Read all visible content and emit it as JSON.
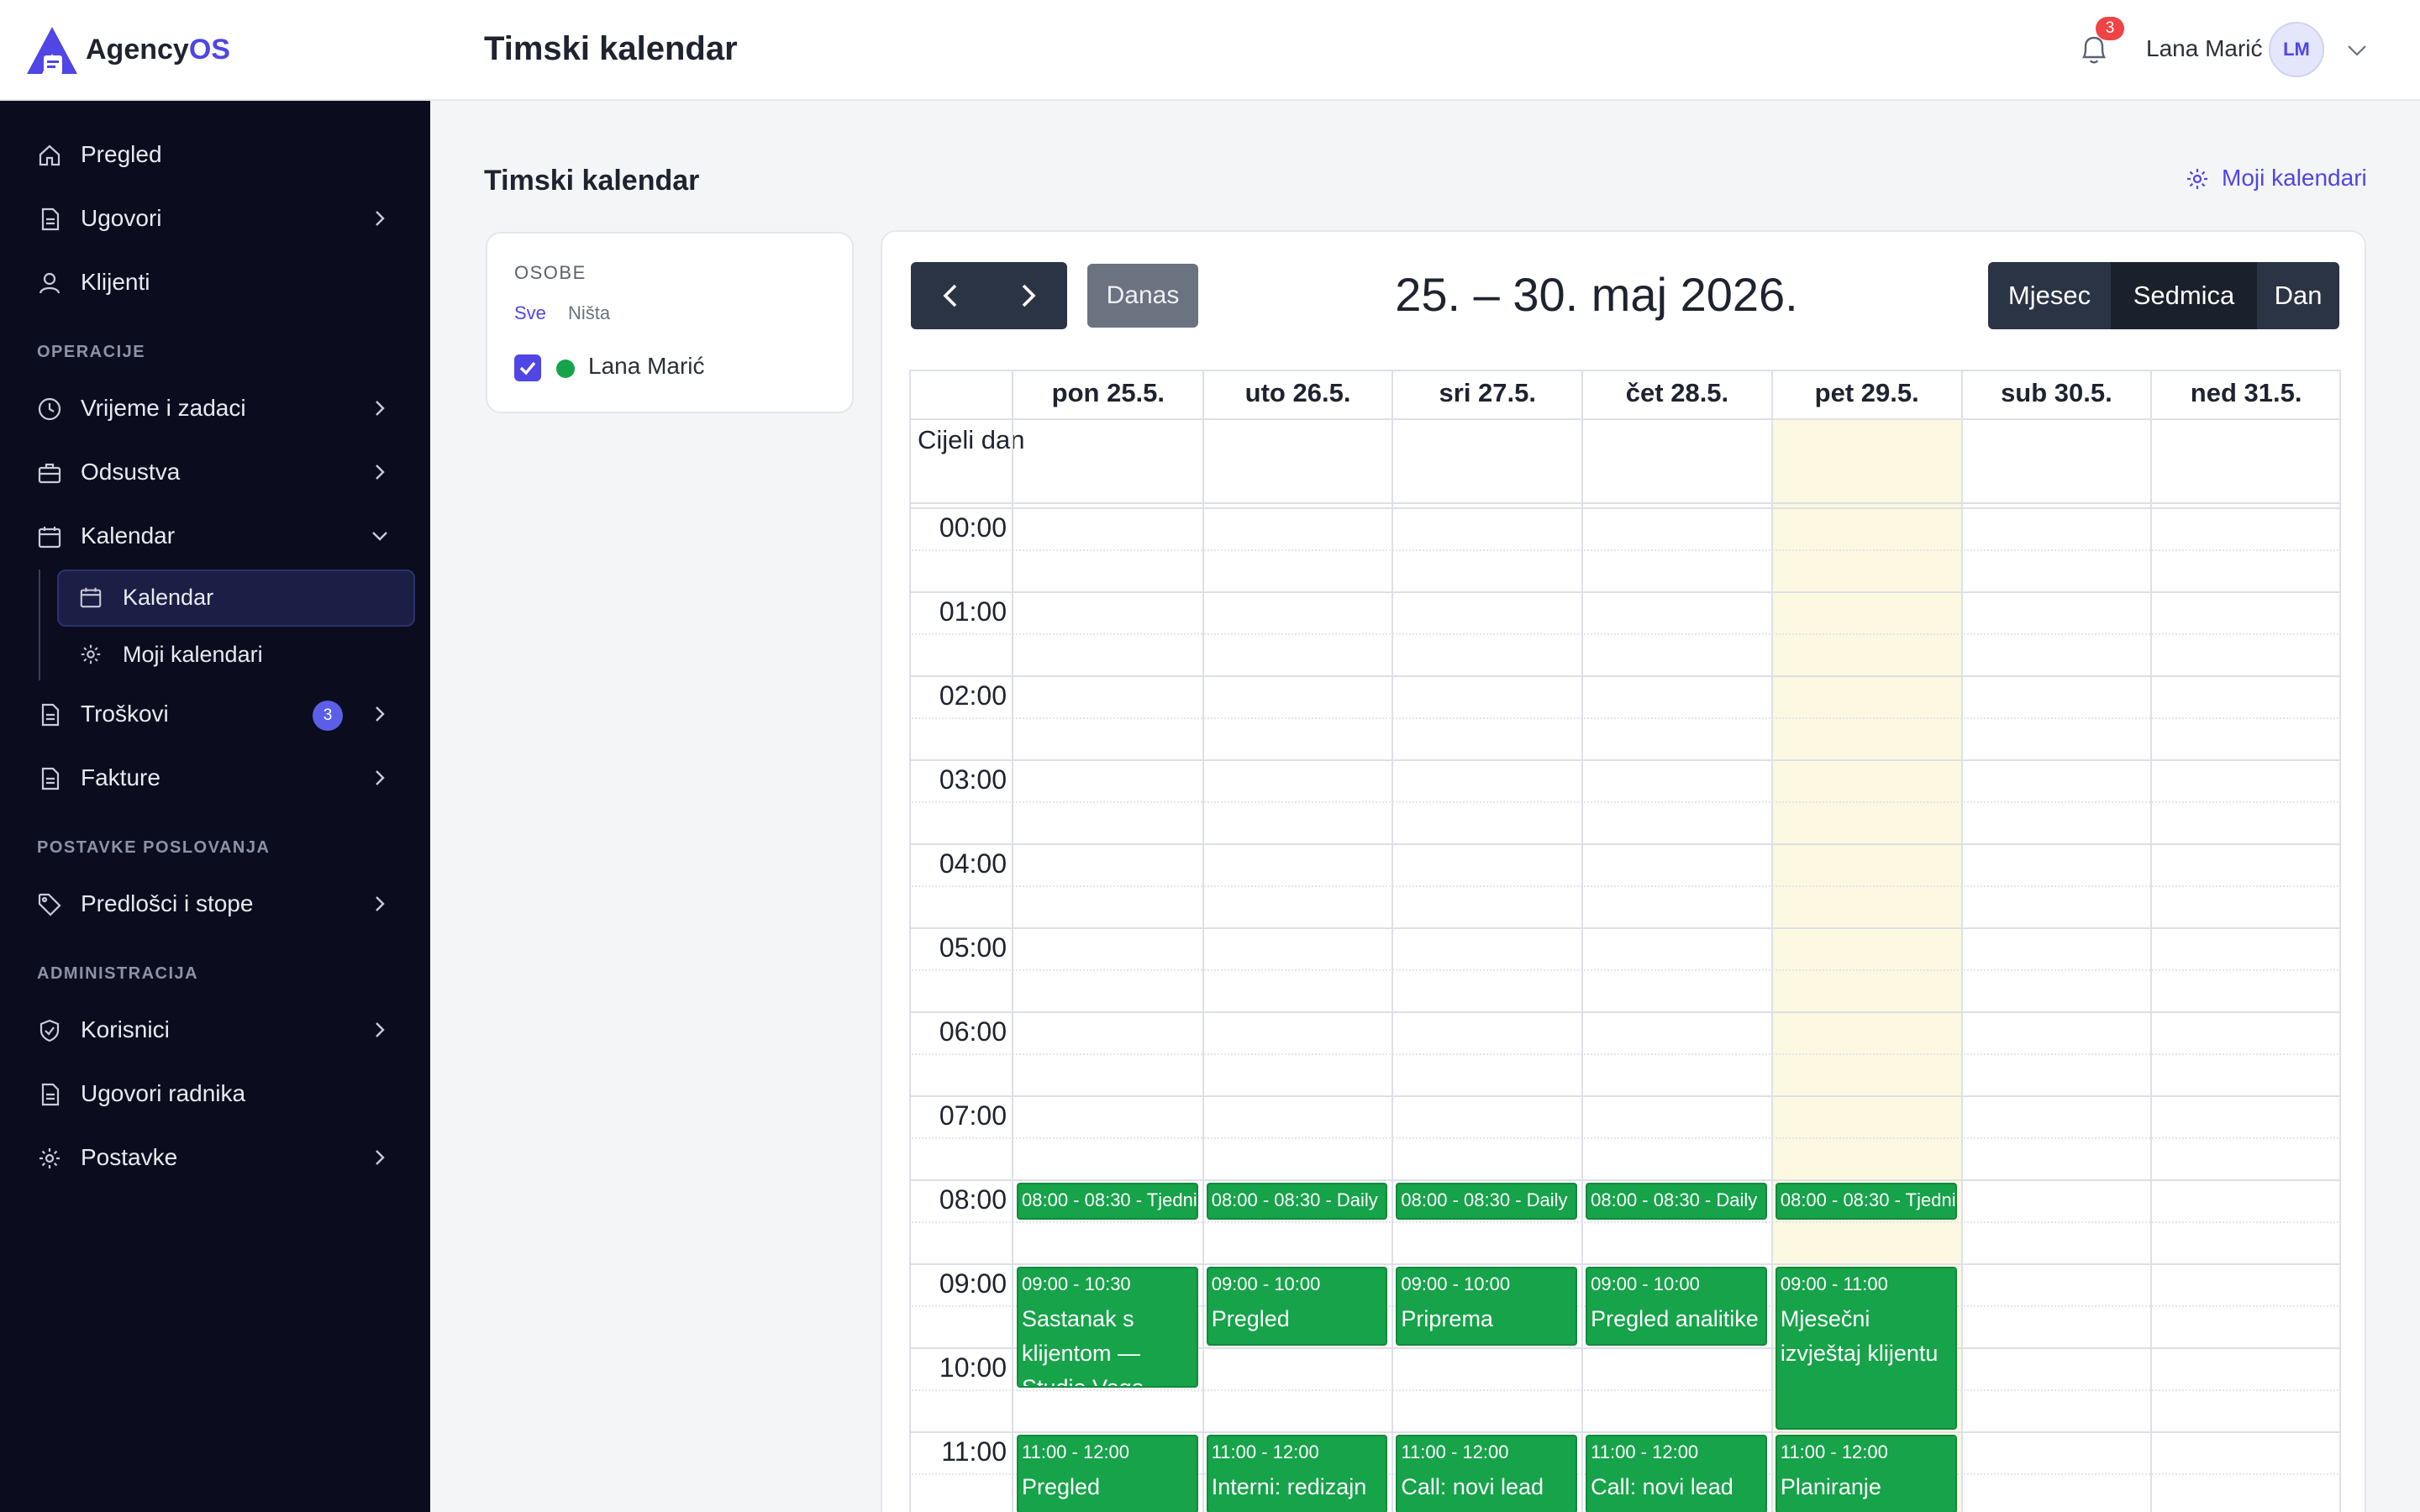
{
  "app": {
    "name_prefix": "Agency",
    "name_suffix": "OS",
    "header_title": "Timski kalendar",
    "colors": {
      "accent": "#4f46e5",
      "sidebar": "#0b0d1e",
      "event": "#16a34a",
      "today": "#fdf8e1"
    }
  },
  "sidebar": {
    "items": [
      {
        "label": "Pregled",
        "icon": "home-icon"
      },
      {
        "label": "Ugovori",
        "icon": "document-icon"
      },
      {
        "label": "Klijenti",
        "icon": "user-icon"
      }
    ],
    "sections": [
      "OPERACIJE",
      "POSTAVKE POSLOVANJA",
      "ADMINISTRACIJA"
    ],
    "operacije": [
      {
        "label": "Vrijeme i zadaci",
        "icon": "clock-icon"
      },
      {
        "label": "Odsustva",
        "icon": "briefcase-icon"
      },
      {
        "label": "Kalendar",
        "icon": "calendar-icon"
      }
    ],
    "kalendar_sub": [
      {
        "label": "Kalendar",
        "icon": "calendar-icon"
      },
      {
        "label": "Moji kalendari",
        "icon": "gear-icon"
      }
    ],
    "troskovi": {
      "label": "Troškovi",
      "badge": "3"
    },
    "fakture": {
      "label": "Fakture"
    },
    "poslovanje": [
      {
        "label": "Predlošci i stope",
        "icon": "tag-icon"
      }
    ],
    "administracija": [
      {
        "label": "Korisnici",
        "icon": "shield-check-icon"
      },
      {
        "label": "Ugovori radnika",
        "icon": "document-icon"
      },
      {
        "label": "Postavke",
        "icon": "gear-icon"
      }
    ]
  },
  "header": {
    "notifications_count": "3",
    "user_name": "Lana Marić",
    "user_initials": "LM"
  },
  "main": {
    "title": "Timski kalendar",
    "my_calendars_link": "Moji kalendari",
    "people": {
      "title": "OSOBE",
      "all": "Sve",
      "none": "Ništa",
      "person": {
        "name": "Lana Marić",
        "checked": true,
        "color": "#16a34a"
      }
    }
  },
  "calendar": {
    "today_label": "Danas",
    "range_title": "25. – 30. maj 2026.",
    "views": [
      "Mjesec",
      "Sedmica",
      "Dan"
    ],
    "active_view": "Sedmica",
    "all_day_label": "Cijeli dan",
    "days": [
      "pon 25.5.",
      "uto 26.5.",
      "sri 27.5.",
      "čet 28.5.",
      "pet 29.5.",
      "sub 30.5.",
      "ned 31.5."
    ],
    "today_index": 4,
    "hours": [
      "00:00",
      "01:00",
      "02:00",
      "03:00",
      "04:00",
      "05:00",
      "06:00",
      "07:00",
      "08:00",
      "09:00",
      "10:00",
      "11:00"
    ],
    "events": [
      {
        "day": 0,
        "start": 8,
        "end": 8.5,
        "time": "08:00 - 08:30 - Tjedni",
        "name": ""
      },
      {
        "day": 1,
        "start": 8,
        "end": 8.5,
        "time": "08:00 - 08:30 - Daily",
        "name": ""
      },
      {
        "day": 2,
        "start": 8,
        "end": 8.5,
        "time": "08:00 - 08:30 - Daily",
        "name": ""
      },
      {
        "day": 3,
        "start": 8,
        "end": 8.5,
        "time": "08:00 - 08:30 - Daily",
        "name": ""
      },
      {
        "day": 4,
        "start": 8,
        "end": 8.5,
        "time": "08:00 - 08:30 - Tjedni",
        "name": ""
      },
      {
        "day": 0,
        "start": 9,
        "end": 10.5,
        "time": "09:00 - 10:30",
        "name": "Sastanak s klijentom — Studio Vega"
      },
      {
        "day": 1,
        "start": 9,
        "end": 10,
        "time": "09:00 - 10:00",
        "name": "Pregled kampanje"
      },
      {
        "day": 2,
        "start": 9,
        "end": 10,
        "time": "09:00 - 10:00",
        "name": "Priprema prezentacije"
      },
      {
        "day": 3,
        "start": 9,
        "end": 10,
        "time": "09:00 - 10:00",
        "name": "Pregled analitike"
      },
      {
        "day": 4,
        "start": 9,
        "end": 11,
        "time": "09:00 - 11:00",
        "name": "Mjesečni izvještaj klijentu"
      },
      {
        "day": 0,
        "start": 11,
        "end": 12,
        "time": "11:00 - 12:00",
        "name": "Pregled"
      },
      {
        "day": 1,
        "start": 11,
        "end": 12,
        "time": "11:00 - 12:00",
        "name": "Interni: redizajn"
      },
      {
        "day": 2,
        "start": 11,
        "end": 12,
        "time": "11:00 - 12:00",
        "name": "Call: novi lead"
      },
      {
        "day": 3,
        "start": 11,
        "end": 12,
        "time": "11:00 - 12:00",
        "name": "Call: novi lead"
      },
      {
        "day": 4,
        "start": 11,
        "end": 12,
        "time": "11:00 - 12:00",
        "name": "Planiranje"
      }
    ]
  }
}
